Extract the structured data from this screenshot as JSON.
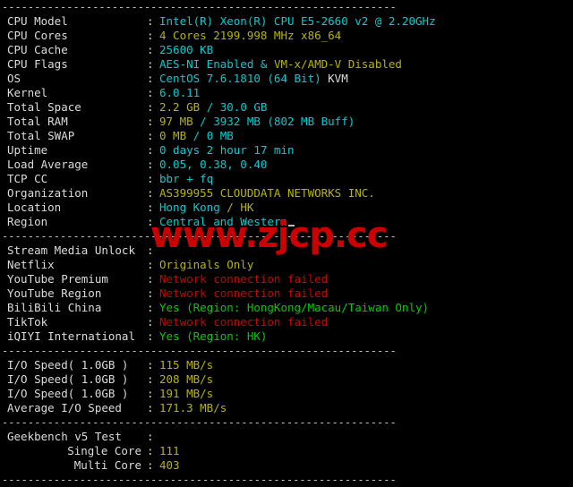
{
  "terminal": {
    "separator": "-------------------------------------------------------------",
    "watermark": "www.zjcp.cc",
    "colon": ":",
    "sections": [
      {
        "id": "system-info",
        "rows": [
          {
            "label": "CPU Model",
            "parts": [
              {
                "text": "Intel(R) Xeon(R) CPU E5-2660 v2 @ 2.20GHz",
                "color": "cyan"
              }
            ]
          },
          {
            "label": "CPU Cores",
            "parts": [
              {
                "text": "4 Cores 2199.998 MHz x86_64",
                "color": "yellow"
              }
            ]
          },
          {
            "label": "CPU Cache",
            "parts": [
              {
                "text": "25600 KB",
                "color": "cyan"
              }
            ]
          },
          {
            "label": "CPU Flags",
            "parts": [
              {
                "text": "AES-NI Enabled & ",
                "color": "cyan"
              },
              {
                "text": "VM-x/AMD-V Disabled",
                "color": "yellow"
              }
            ]
          },
          {
            "label": "OS",
            "parts": [
              {
                "text": "CentOS 7.6.1810 (64 Bit) ",
                "color": "cyan"
              },
              {
                "text": "KVM",
                "color": "gray"
              }
            ]
          },
          {
            "label": "Kernel",
            "parts": [
              {
                "text": "6.0.11",
                "color": "cyan"
              }
            ]
          },
          {
            "label": "Total Space",
            "parts": [
              {
                "text": "2.2 GB ",
                "color": "yellow"
              },
              {
                "text": "/ 30.0 GB",
                "color": "cyan"
              }
            ]
          },
          {
            "label": "Total RAM",
            "parts": [
              {
                "text": "97 MB ",
                "color": "yellow"
              },
              {
                "text": "/ 3932 MB (802 MB Buff)",
                "color": "cyan"
              }
            ]
          },
          {
            "label": "Total SWAP",
            "parts": [
              {
                "text": "0 MB ",
                "color": "yellow"
              },
              {
                "text": "/ 0 MB",
                "color": "cyan"
              }
            ]
          },
          {
            "label": "Uptime",
            "parts": [
              {
                "text": "0 days 2 hour 17 min",
                "color": "cyan"
              }
            ]
          },
          {
            "label": "Load Average",
            "parts": [
              {
                "text": "0.05, 0.38, 0.40",
                "color": "cyan"
              }
            ]
          },
          {
            "label": "TCP CC",
            "parts": [
              {
                "text": "bbr + fq",
                "color": "cyan"
              }
            ]
          },
          {
            "label": "Organization",
            "parts": [
              {
                "text": "AS399955 CLOUDDATA NETWORKS INC.",
                "color": "yellow"
              }
            ]
          },
          {
            "label": "Location",
            "parts": [
              {
                "text": "Hong Kong ",
                "color": "cyan"
              },
              {
                "text": "/ HK",
                "color": "yellow"
              }
            ]
          },
          {
            "label": "Region",
            "parts": [
              {
                "text": "Central and Western",
                "color": "cyan"
              }
            ],
            "cursor": true
          }
        ]
      },
      {
        "id": "stream-media-unlock",
        "rows": [
          {
            "label": "Stream Media Unlock",
            "parts": []
          },
          {
            "label": "Netflix",
            "parts": [
              {
                "text": "Originals Only",
                "color": "yellow"
              }
            ]
          },
          {
            "label": "YouTube Premium",
            "parts": [
              {
                "text": "Network connection failed",
                "color": "red"
              }
            ]
          },
          {
            "label": "YouTube Region",
            "parts": [
              {
                "text": "Network connection failed",
                "color": "red"
              }
            ]
          },
          {
            "label": "BiliBili China",
            "parts": [
              {
                "text": "Yes (Region: HongKong/Macau/Taiwan Only)",
                "color": "green"
              }
            ]
          },
          {
            "label": "TikTok",
            "parts": [
              {
                "text": "Network connection failed",
                "color": "red"
              }
            ]
          },
          {
            "label": "iQIYI International",
            "parts": [
              {
                "text": "Yes (Region: HK)",
                "color": "green"
              }
            ]
          }
        ]
      },
      {
        "id": "io-speed",
        "rows": [
          {
            "label": "I/O Speed( 1.0GB )",
            "parts": [
              {
                "text": "115 MB/s",
                "color": "yellow"
              }
            ]
          },
          {
            "label": "I/O Speed( 1.0GB )",
            "parts": [
              {
                "text": "208 MB/s",
                "color": "yellow"
              }
            ]
          },
          {
            "label": "I/O Speed( 1.0GB )",
            "parts": [
              {
                "text": "191 MB/s",
                "color": "yellow"
              }
            ]
          },
          {
            "label": "Average I/O Speed",
            "parts": [
              {
                "text": "171.3 MB/s",
                "color": "yellow"
              }
            ]
          }
        ]
      },
      {
        "id": "geekbench",
        "rows": [
          {
            "label": "Geekbench v5 Test",
            "parts": []
          },
          {
            "label": "Single Core",
            "indent": true,
            "parts": [
              {
                "text": "111",
                "color": "yellow"
              }
            ]
          },
          {
            "label": "Multi Core",
            "indent": true,
            "parts": [
              {
                "text": "403",
                "color": "yellow"
              }
            ]
          }
        ]
      }
    ]
  }
}
